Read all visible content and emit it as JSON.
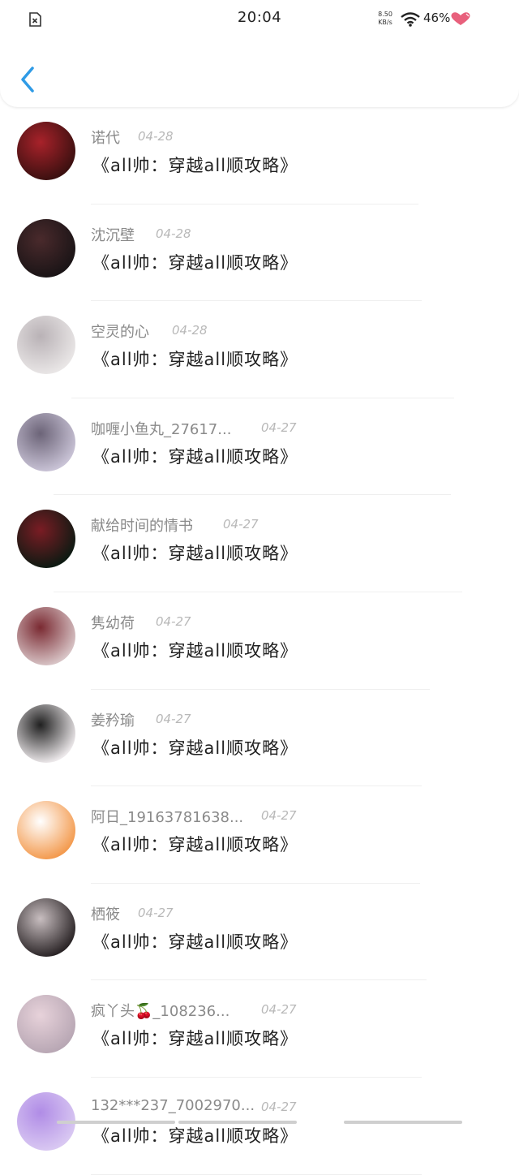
{
  "status_bar": {
    "time": "20:04",
    "net_speed_value": "8.50",
    "net_speed_unit": "KB/s",
    "battery": "46%"
  },
  "colors": {
    "accent": "#2f9be6",
    "name_text": "#8a8a8a",
    "date_text": "#b8b8b8",
    "heart": "#e8607c"
  },
  "items": [
    {
      "name": "诺代",
      "date": "04-28",
      "title": "《all帅：穿越all顺攻略》",
      "avatar_colors": [
        "#3b1010",
        "#a8222a"
      ]
    },
    {
      "name": "沈沉壁",
      "date": "04-28",
      "title": "《all帅：穿越all顺攻略》",
      "avatar_colors": [
        "#1a1416",
        "#4a2a2c"
      ]
    },
    {
      "name": "空灵的心",
      "date": "04-28",
      "title": "《all帅：穿越all顺攻略》",
      "avatar_colors": [
        "#e9e6e6",
        "#b9b2b6"
      ]
    },
    {
      "name": "咖喱小鱼丸_27617...",
      "date": "04-27",
      "title": "《all帅：穿越all顺攻略》",
      "avatar_colors": [
        "#c9c3d6",
        "#6c6478"
      ]
    },
    {
      "name": "献给时间的情书",
      "date": "04-27",
      "title": "《all帅：穿越all顺攻略》",
      "avatar_colors": [
        "#0d1a12",
        "#7a1c24"
      ]
    },
    {
      "name": "隽幼荷",
      "date": "04-27",
      "title": "《all帅：穿越all顺攻略》",
      "avatar_colors": [
        "#d8c4c6",
        "#7a2a32"
      ]
    },
    {
      "name": "姜矜瑜",
      "date": "04-27",
      "title": "《all帅：穿越all顺攻略》",
      "avatar_colors": [
        "#ece8ea",
        "#202020"
      ]
    },
    {
      "name": "阿日_19163781638...",
      "date": "04-27",
      "title": "《all帅：穿越all顺攻略》",
      "avatar_colors": [
        "#f39a4e",
        "#ffffff"
      ]
    },
    {
      "name": "栖筱",
      "date": "04-27",
      "title": "《all帅：穿越all顺攻略》",
      "avatar_colors": [
        "#2a2426",
        "#c8bec0"
      ]
    },
    {
      "name": "疯丫头🍒_108236...",
      "date": "04-27",
      "title": "《all帅：穿越all顺攻略》",
      "avatar_colors": [
        "#b8a7b4",
        "#e7d2da"
      ]
    },
    {
      "name": "132***237_7002970...",
      "date": "04-27",
      "title": "《all帅：穿越all顺攻略》",
      "avatar_colors": [
        "#d9c8f2",
        "#b08ce6"
      ]
    }
  ]
}
